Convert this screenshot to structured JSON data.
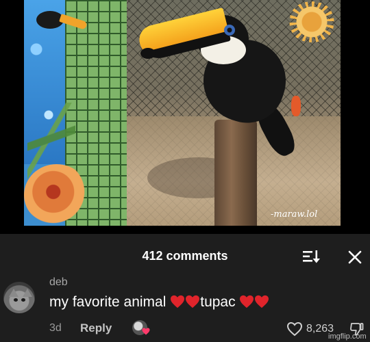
{
  "media": {
    "artist_signature": "-maraw.lol"
  },
  "comments_panel": {
    "title": "412 comments",
    "sort_icon": "sort-icon",
    "close_icon": "close-icon"
  },
  "comment": {
    "username": "deb",
    "text_part1": "my favorite animal ",
    "text_part2": "tupac ",
    "emoji": "red-heart-emoji",
    "time": "3d",
    "reply_label": "Reply",
    "like_count": "8,263",
    "like_icon": "heart-outline-icon",
    "dislike_icon": "thumbs-down-icon",
    "accent_heart_color": "#e0242b"
  },
  "watermark": "imgflip.com"
}
